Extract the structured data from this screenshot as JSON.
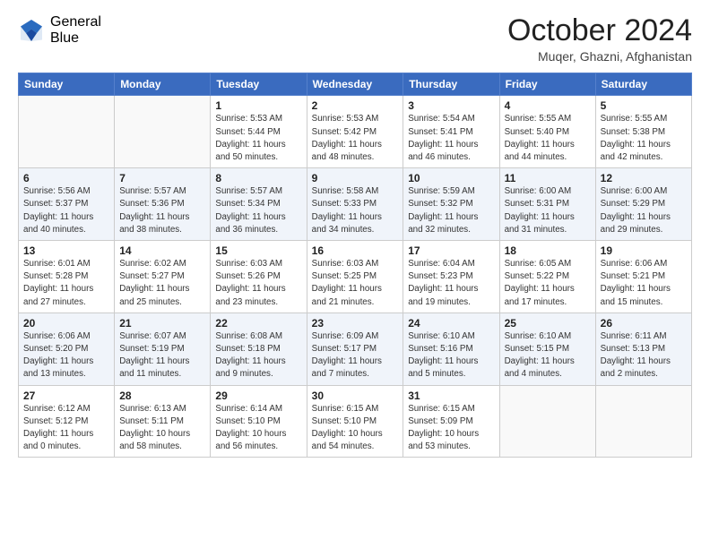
{
  "header": {
    "logo_general": "General",
    "logo_blue": "Blue",
    "month_title": "October 2024",
    "location": "Muqer, Ghazni, Afghanistan"
  },
  "weekdays": [
    "Sunday",
    "Monday",
    "Tuesday",
    "Wednesday",
    "Thursday",
    "Friday",
    "Saturday"
  ],
  "weeks": [
    [
      {
        "day": "",
        "info": ""
      },
      {
        "day": "",
        "info": ""
      },
      {
        "day": "1",
        "info": "Sunrise: 5:53 AM\nSunset: 5:44 PM\nDaylight: 11 hours and 50 minutes."
      },
      {
        "day": "2",
        "info": "Sunrise: 5:53 AM\nSunset: 5:42 PM\nDaylight: 11 hours and 48 minutes."
      },
      {
        "day": "3",
        "info": "Sunrise: 5:54 AM\nSunset: 5:41 PM\nDaylight: 11 hours and 46 minutes."
      },
      {
        "day": "4",
        "info": "Sunrise: 5:55 AM\nSunset: 5:40 PM\nDaylight: 11 hours and 44 minutes."
      },
      {
        "day": "5",
        "info": "Sunrise: 5:55 AM\nSunset: 5:38 PM\nDaylight: 11 hours and 42 minutes."
      }
    ],
    [
      {
        "day": "6",
        "info": "Sunrise: 5:56 AM\nSunset: 5:37 PM\nDaylight: 11 hours and 40 minutes."
      },
      {
        "day": "7",
        "info": "Sunrise: 5:57 AM\nSunset: 5:36 PM\nDaylight: 11 hours and 38 minutes."
      },
      {
        "day": "8",
        "info": "Sunrise: 5:57 AM\nSunset: 5:34 PM\nDaylight: 11 hours and 36 minutes."
      },
      {
        "day": "9",
        "info": "Sunrise: 5:58 AM\nSunset: 5:33 PM\nDaylight: 11 hours and 34 minutes."
      },
      {
        "day": "10",
        "info": "Sunrise: 5:59 AM\nSunset: 5:32 PM\nDaylight: 11 hours and 32 minutes."
      },
      {
        "day": "11",
        "info": "Sunrise: 6:00 AM\nSunset: 5:31 PM\nDaylight: 11 hours and 31 minutes."
      },
      {
        "day": "12",
        "info": "Sunrise: 6:00 AM\nSunset: 5:29 PM\nDaylight: 11 hours and 29 minutes."
      }
    ],
    [
      {
        "day": "13",
        "info": "Sunrise: 6:01 AM\nSunset: 5:28 PM\nDaylight: 11 hours and 27 minutes."
      },
      {
        "day": "14",
        "info": "Sunrise: 6:02 AM\nSunset: 5:27 PM\nDaylight: 11 hours and 25 minutes."
      },
      {
        "day": "15",
        "info": "Sunrise: 6:03 AM\nSunset: 5:26 PM\nDaylight: 11 hours and 23 minutes."
      },
      {
        "day": "16",
        "info": "Sunrise: 6:03 AM\nSunset: 5:25 PM\nDaylight: 11 hours and 21 minutes."
      },
      {
        "day": "17",
        "info": "Sunrise: 6:04 AM\nSunset: 5:23 PM\nDaylight: 11 hours and 19 minutes."
      },
      {
        "day": "18",
        "info": "Sunrise: 6:05 AM\nSunset: 5:22 PM\nDaylight: 11 hours and 17 minutes."
      },
      {
        "day": "19",
        "info": "Sunrise: 6:06 AM\nSunset: 5:21 PM\nDaylight: 11 hours and 15 minutes."
      }
    ],
    [
      {
        "day": "20",
        "info": "Sunrise: 6:06 AM\nSunset: 5:20 PM\nDaylight: 11 hours and 13 minutes."
      },
      {
        "day": "21",
        "info": "Sunrise: 6:07 AM\nSunset: 5:19 PM\nDaylight: 11 hours and 11 minutes."
      },
      {
        "day": "22",
        "info": "Sunrise: 6:08 AM\nSunset: 5:18 PM\nDaylight: 11 hours and 9 minutes."
      },
      {
        "day": "23",
        "info": "Sunrise: 6:09 AM\nSunset: 5:17 PM\nDaylight: 11 hours and 7 minutes."
      },
      {
        "day": "24",
        "info": "Sunrise: 6:10 AM\nSunset: 5:16 PM\nDaylight: 11 hours and 5 minutes."
      },
      {
        "day": "25",
        "info": "Sunrise: 6:10 AM\nSunset: 5:15 PM\nDaylight: 11 hours and 4 minutes."
      },
      {
        "day": "26",
        "info": "Sunrise: 6:11 AM\nSunset: 5:13 PM\nDaylight: 11 hours and 2 minutes."
      }
    ],
    [
      {
        "day": "27",
        "info": "Sunrise: 6:12 AM\nSunset: 5:12 PM\nDaylight: 11 hours and 0 minutes."
      },
      {
        "day": "28",
        "info": "Sunrise: 6:13 AM\nSunset: 5:11 PM\nDaylight: 10 hours and 58 minutes."
      },
      {
        "day": "29",
        "info": "Sunrise: 6:14 AM\nSunset: 5:10 PM\nDaylight: 10 hours and 56 minutes."
      },
      {
        "day": "30",
        "info": "Sunrise: 6:15 AM\nSunset: 5:10 PM\nDaylight: 10 hours and 54 minutes."
      },
      {
        "day": "31",
        "info": "Sunrise: 6:15 AM\nSunset: 5:09 PM\nDaylight: 10 hours and 53 minutes."
      },
      {
        "day": "",
        "info": ""
      },
      {
        "day": "",
        "info": ""
      }
    ]
  ]
}
